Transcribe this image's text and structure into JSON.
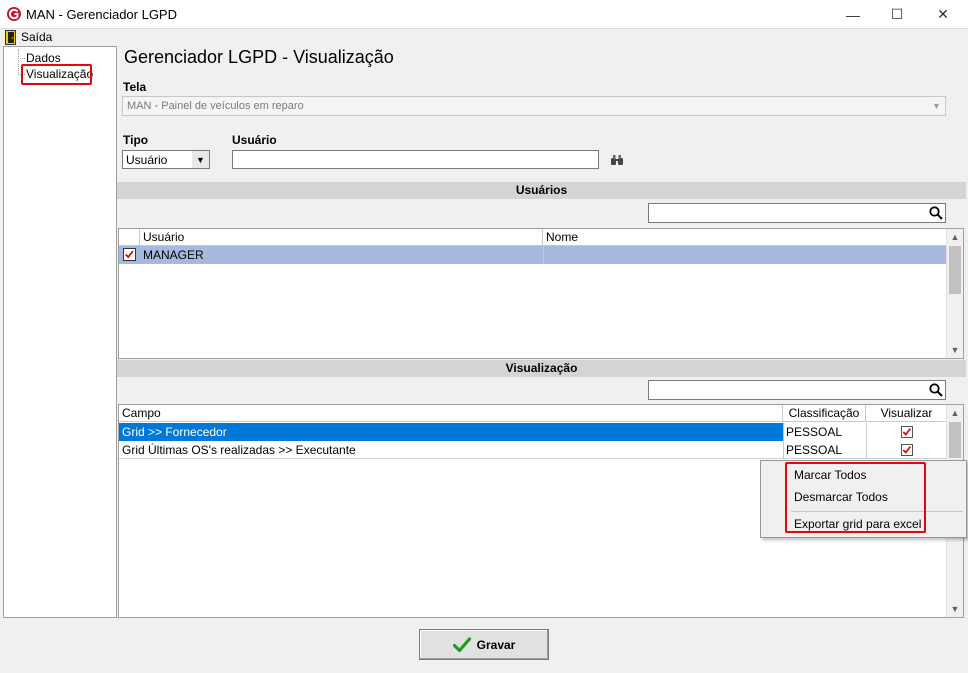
{
  "window": {
    "title": "MAN - Gerenciador LGPD",
    "minimize_glyph": "—",
    "maximize_glyph": "☐",
    "close_glyph": "✕"
  },
  "menu": {
    "exit_label": "Saída"
  },
  "tree": {
    "items": [
      {
        "label": "Dados"
      },
      {
        "label": "Visualização"
      }
    ]
  },
  "page": {
    "title": "Gerenciador LGPD - Visualização"
  },
  "form": {
    "tela_label": "Tela",
    "tela_value": "MAN - Painel de veículos em reparo",
    "tipo_label": "Tipo",
    "tipo_value": "Usuário",
    "usuario_label": "Usuário",
    "usuario_value": ""
  },
  "usuarios_section": {
    "header": "Usuários",
    "search_value": "",
    "columns": [
      "Usuário",
      "Nome"
    ],
    "rows": [
      {
        "usuario": "MANAGER",
        "nome": "",
        "checked": true
      }
    ]
  },
  "visualizacao_section": {
    "header": "Visualização",
    "search_value": "",
    "columns": [
      "Campo",
      "Classificação",
      "Visualizar"
    ],
    "rows": [
      {
        "campo": "Grid >> Fornecedor",
        "classificacao": "PESSOAL",
        "visualizar": true
      },
      {
        "campo": "Grid Últimas OS's realizadas >> Executante",
        "classificacao": "PESSOAL",
        "visualizar": true
      }
    ]
  },
  "context_menu": {
    "mark_all": "Marcar Todos",
    "unmark_all": "Desmarcar Todos",
    "export": "Exportar grid para excel"
  },
  "actions": {
    "save_label": "Gravar"
  },
  "colors": {
    "selected_row": "#0078d7",
    "checked_user_row": "#a6b9e0",
    "highlight_box": "#e30613",
    "check_mark": "#d40000",
    "save_icon": "#1f9d1f"
  },
  "icons": {
    "app": "man-logo-icon",
    "exit": "exit-door-icon",
    "find": "binoculars-icon",
    "search": "search-icon",
    "save": "checkmark-icon"
  }
}
